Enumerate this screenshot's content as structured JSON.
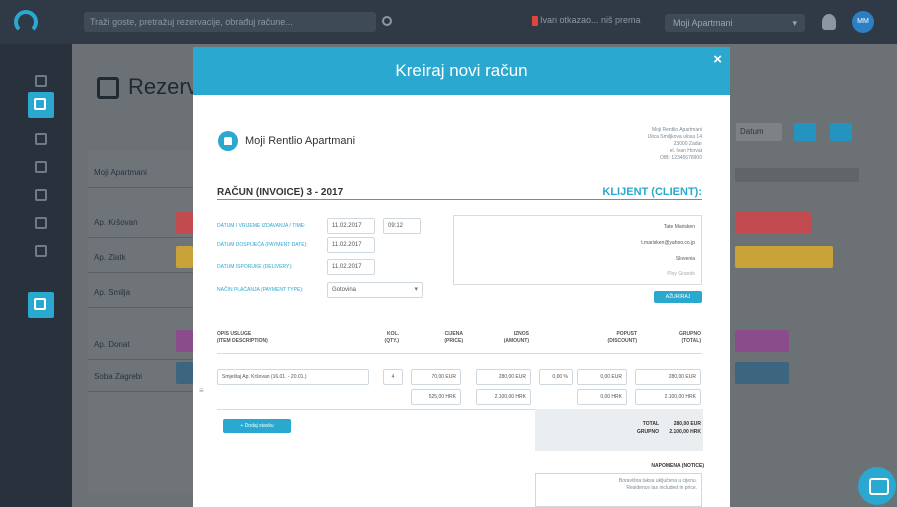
{
  "background": {
    "search_placeholder": "Traži goste, pretražuj rezervacije, obrađuj račune...",
    "notice": "Ivan otkazao... niš prema",
    "property_select": "Moji Apartmani",
    "avatar_initials": "MM",
    "page_title": "Rezerv",
    "list_header": "Moji Apartmani",
    "rows": [
      "Ap. Kršovan",
      "Ap. Zlatk",
      "Ap. Smilja",
      "Ap. Donat",
      "Soba Zagrebi"
    ],
    "right_select": "Datum"
  },
  "modal": {
    "title": "Kreiraj novi račun",
    "close": "×",
    "company_name": "Moji Rentlio Apartmani",
    "company_address": [
      "Moji Rentlio Apartmani",
      "Ulica Smiljkova ulosa 14",
      "23000 Zadar",
      "el. Ivan Horvat",
      "OIB: 12345678900"
    ],
    "invoice_title": "RAČUN (INVOICE) 3 - 2017",
    "client_title": "KLIJENT (CLIENT):",
    "fields": {
      "issue_label": "DATUM I VRIJEME IZDAVANJA / TIME:",
      "issue_date": "11.02.2017",
      "issue_time": "09:12",
      "due_label": "DATUM DOSPIJEĆA (PAYMENT DATE):",
      "due_date": "11.02.2017",
      "delivery_label": "DATUM ISPORUKE (DELIVERY):",
      "delivery_date": "11.02.2017",
      "payment_label": "NAČIN PLAĆANJA (PAYMENT TYPE):",
      "payment_type": "Gotovina"
    },
    "client": {
      "name": "Tate Marisken",
      "email": "t.marisken@yahoo.co.jp",
      "country": "Slovenia",
      "extra": "Ploy Grande"
    },
    "update_button": "AŽURIRAJ",
    "table": {
      "headers": {
        "desc": "OPIS USLUGE\n(ITEM DESCRIPTION)",
        "qty": "KOL.\n(QTY.)",
        "price": "CIJENA\n(PRICE)",
        "amount": "IZNOS\n(AMOUNT)",
        "discount": "POPUST\n(DISCOUNT)",
        "total": "GRUPNO\n(TOTAL)"
      },
      "row": {
        "desc": "Smještaj Ap. Kršovan (16.01. - 20.01.)",
        "qty": "4",
        "price_eur": "70,00 EUR",
        "amount_eur": "280,00 EUR",
        "discount_pct": "0,00 %",
        "discount_eur": "0,00 EUR",
        "total_eur": "280,00 EUR",
        "price_hrk": "525,00 HRK",
        "amount_hrk": "2.100,00 HRK",
        "discount_hrk": "0,00 HRK",
        "total_hrk": "2.100,00 HRK"
      }
    },
    "add_item_button": "+  Dodaj stavku",
    "totals": {
      "label": "TOTAL\nGRUPNO",
      "value": "280,00 EUR\n2.100,00 HRK"
    },
    "note_title": "NAPOMENA (NOTICE)",
    "note_text": "Boravišna taksa uključena u cijenu.\nResidence tax included in price."
  },
  "colors": {
    "accent": "#2aa8cf",
    "topbar": "#2f3a46",
    "sidebar": "#29323c"
  }
}
